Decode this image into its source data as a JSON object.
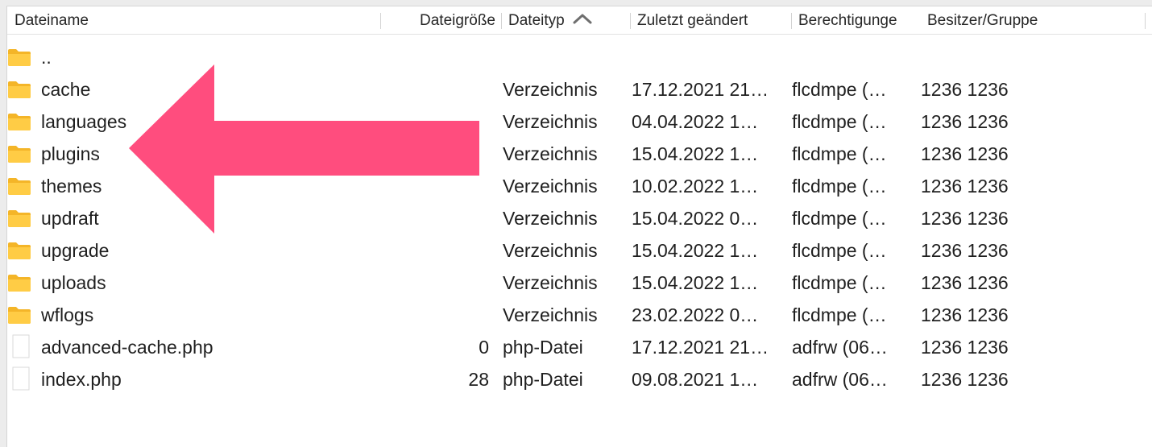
{
  "columns": {
    "name": "Dateiname",
    "size": "Dateigröße",
    "type": "Dateityp",
    "modified": "Zuletzt geändert",
    "permissions": "Berechtigunge",
    "owner": "Besitzer/Gruppe"
  },
  "sort": {
    "column": "Dateityp",
    "direction": "ascending",
    "icon": "chevron-up-icon"
  },
  "parent_entry": "..",
  "rows": [
    {
      "icon": "folder-icon",
      "name": "cache",
      "size": "",
      "type": "Verzeichnis",
      "modified": "17.12.2021 21…",
      "permissions": "flcdmpe (…",
      "owner": "1236 1236"
    },
    {
      "icon": "folder-icon",
      "name": "languages",
      "size": "",
      "type": "Verzeichnis",
      "modified": "04.04.2022 1…",
      "permissions": "flcdmpe (…",
      "owner": "1236 1236"
    },
    {
      "icon": "folder-icon",
      "name": "plugins",
      "size": "",
      "type": "Verzeichnis",
      "modified": "15.04.2022 1…",
      "permissions": "flcdmpe (…",
      "owner": "1236 1236"
    },
    {
      "icon": "folder-icon",
      "name": "themes",
      "size": "",
      "type": "Verzeichnis",
      "modified": "10.02.2022 1…",
      "permissions": "flcdmpe (…",
      "owner": "1236 1236"
    },
    {
      "icon": "folder-icon",
      "name": "updraft",
      "size": "",
      "type": "Verzeichnis",
      "modified": "15.04.2022 0…",
      "permissions": "flcdmpe (…",
      "owner": "1236 1236"
    },
    {
      "icon": "folder-icon",
      "name": "upgrade",
      "size": "",
      "type": "Verzeichnis",
      "modified": "15.04.2022 1…",
      "permissions": "flcdmpe (…",
      "owner": "1236 1236"
    },
    {
      "icon": "folder-icon",
      "name": "uploads",
      "size": "",
      "type": "Verzeichnis",
      "modified": "15.04.2022 1…",
      "permissions": "flcdmpe (…",
      "owner": "1236 1236"
    },
    {
      "icon": "folder-icon",
      "name": "wflogs",
      "size": "",
      "type": "Verzeichnis",
      "modified": "23.02.2022 0…",
      "permissions": "flcdmpe (…",
      "owner": "1236 1236"
    },
    {
      "icon": "file-icon",
      "name": "advanced-cache.php",
      "size": "0",
      "type": "php-Datei",
      "modified": "17.12.2021 21…",
      "permissions": "adfrw (06…",
      "owner": "1236 1236"
    },
    {
      "icon": "file-icon",
      "name": "index.php",
      "size": "28",
      "type": "php-Datei",
      "modified": "09.08.2021 1…",
      "permissions": "adfrw (06…",
      "owner": "1236 1236"
    }
  ],
  "annotation": {
    "shape": "arrow-left",
    "color": "#ff4d7e",
    "points_to": "plugins"
  },
  "colors": {
    "folder": "#ffcc45",
    "folder_back": "#f4b528",
    "header_border": "#e2e2e2"
  }
}
